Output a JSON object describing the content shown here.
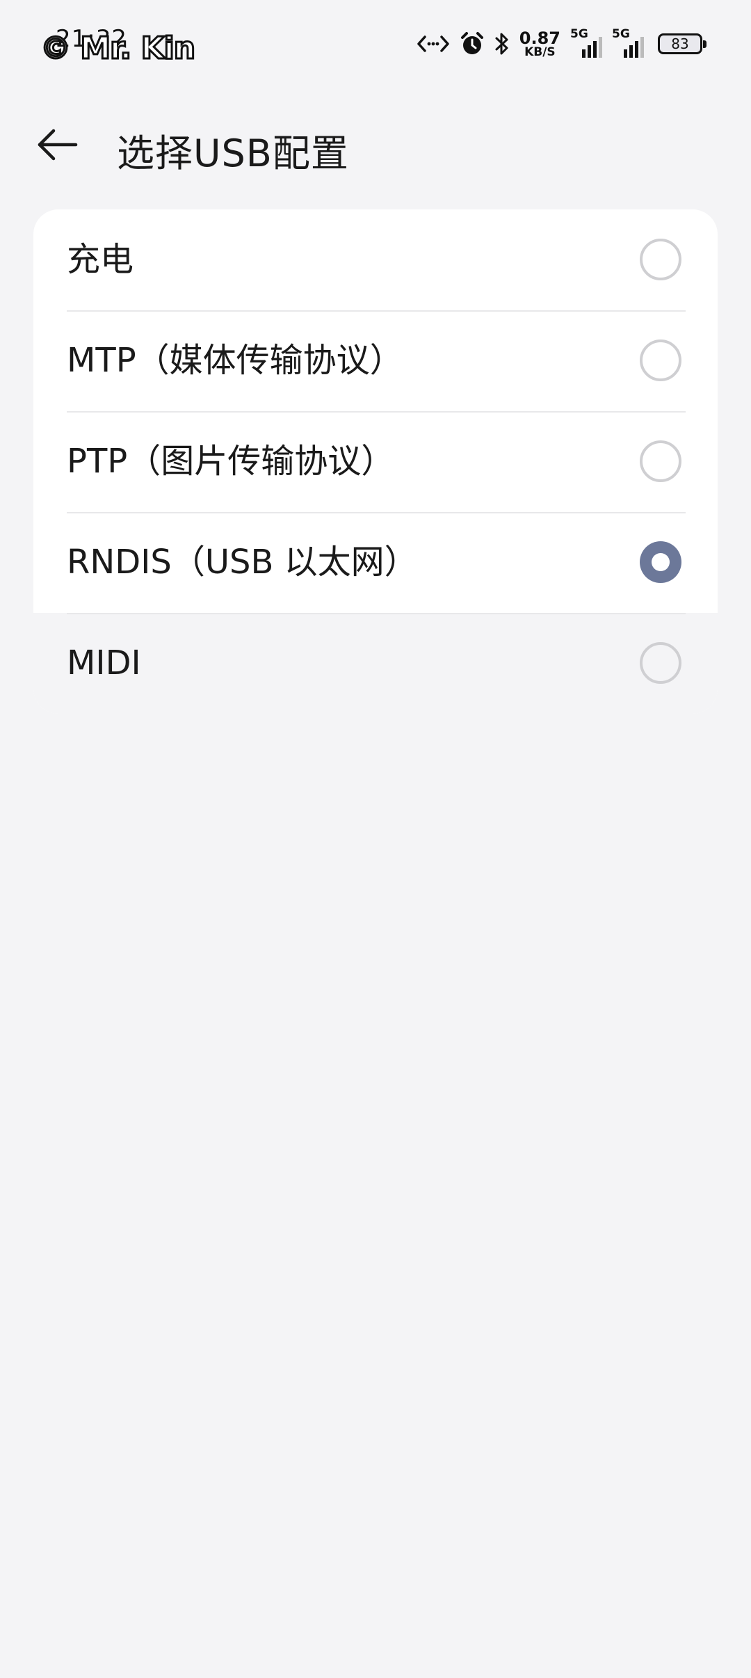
{
  "status_bar": {
    "time": "21:32",
    "watermark": "© Mr. Kin",
    "net_speed_value": "0.87",
    "net_speed_unit": "KB/S",
    "sim1_tag": "5G",
    "sim2_tag": "5G",
    "battery_level": "83",
    "icons": [
      "data-transfer-icon",
      "alarm-icon",
      "bluetooth-icon",
      "signal-icon",
      "signal-icon",
      "battery-icon"
    ]
  },
  "toolbar": {
    "back_icon": "arrow-left-icon",
    "title": "选择USB配置"
  },
  "options": [
    {
      "label": "充电",
      "selected": false
    },
    {
      "label": "MTP（媒体传输协议）",
      "selected": false
    },
    {
      "label": "PTP（图片传输协议）",
      "selected": false
    },
    {
      "label": "RNDIS（USB 以太网）",
      "selected": true
    },
    {
      "label": "MIDI",
      "selected": false
    }
  ],
  "colors": {
    "background": "#f4f4f6",
    "card": "#ffffff",
    "radio_selected": "#6c7899",
    "radio_unselected_border": "#cfcfd2",
    "text": "#1a1a1a"
  }
}
